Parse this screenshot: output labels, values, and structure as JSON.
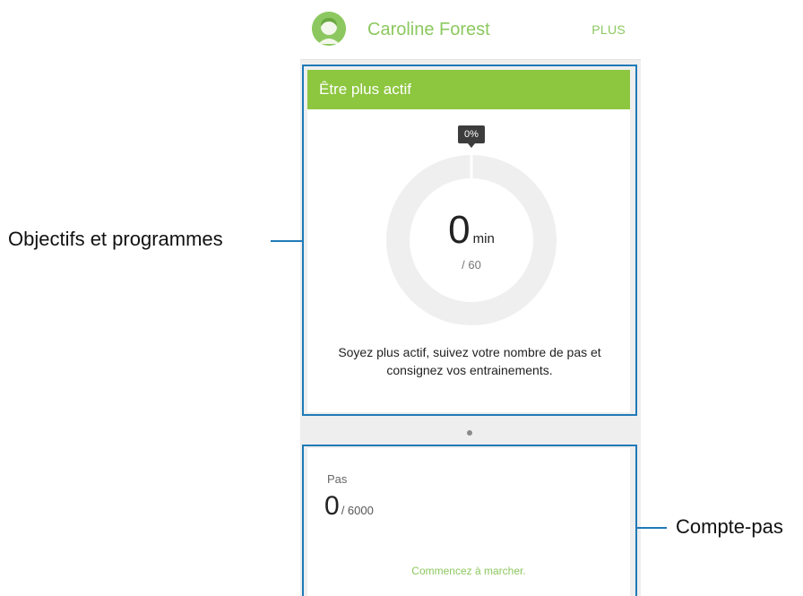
{
  "header": {
    "user_name": "Caroline Forest",
    "more_label": "PLUS"
  },
  "goal_card": {
    "title": "Être plus actif",
    "progress_badge": "0%",
    "progress_fraction": 0.0,
    "value": "0",
    "unit": "min",
    "target": "/ 60",
    "description": "Soyez plus actif, suivez votre nombre de pas et consignez vos entrainements."
  },
  "pager": {
    "active_index": 0
  },
  "steps_card": {
    "label": "Pas",
    "value": "0",
    "goal": "/ 6000",
    "cta": "Commencez à marcher."
  },
  "callouts": {
    "goal_label": "Objectifs et programmes",
    "steps_label": "Compte-pas"
  },
  "colors": {
    "accent": "#8dc63f",
    "callout": "#1f7ab8",
    "ring_track": "#efefef",
    "badge": "#3c3c3c"
  }
}
